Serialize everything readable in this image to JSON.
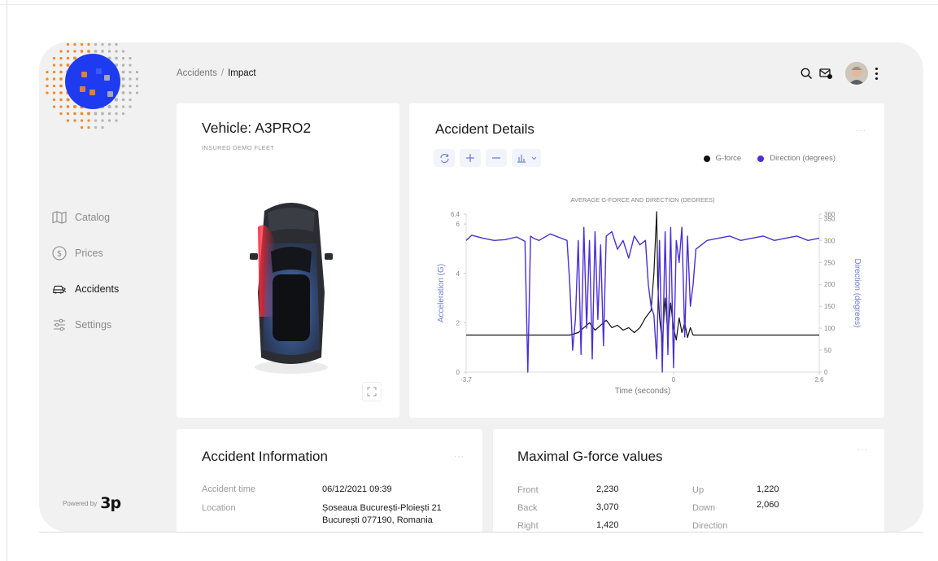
{
  "breadcrumb": {
    "parent": "Accidents",
    "separator": "/",
    "current": "Impact"
  },
  "sidebar": {
    "items": [
      {
        "label": "Catalog",
        "icon": "map-icon"
      },
      {
        "label": "Prices",
        "icon": "dollar-circle-icon"
      },
      {
        "label": "Accidents",
        "icon": "car-crash-icon",
        "active": true
      },
      {
        "label": "Settings",
        "icon": "sliders-icon"
      }
    ],
    "powered_by": "Powered by",
    "brand": "3p"
  },
  "vehicle": {
    "title": "Vehicle: A3PRO2",
    "subtitle": "INSURED DEMO FLEET"
  },
  "details": {
    "title": "Accident Details",
    "legend": [
      {
        "name": "G-force",
        "color": "#111111"
      },
      {
        "name": "Direction (degrees)",
        "color": "#4b2fd6"
      }
    ]
  },
  "chart_data": {
    "type": "line",
    "title": "AVERAGE G-FORCE AND DIRECTION (DEGREES)",
    "xlabel": "Time (seconds)",
    "ylabel": "Acceleration (G)",
    "y2label": "Direction (degrees)",
    "xlim": [
      -3.7,
      2.6
    ],
    "ylim": [
      0,
      6.4
    ],
    "y2lim": [
      0,
      360
    ],
    "x_ticks": [
      "-3.7",
      "0",
      "2.6"
    ],
    "y_ticks": [
      "0",
      "2",
      "4",
      "6",
      "6.4"
    ],
    "y2_ticks": [
      "0",
      "50",
      "100",
      "150",
      "200",
      "250",
      "300",
      "350",
      "360"
    ],
    "series": [
      {
        "name": "G-force",
        "axis": "left",
        "color": "#111111",
        "x": [
          -3.7,
          -1.85,
          -1.7,
          -1.6,
          -1.5,
          -1.4,
          -1.3,
          -1.2,
          -1.1,
          -1.0,
          -0.9,
          -0.8,
          -0.7,
          -0.6,
          -0.5,
          -0.4,
          -0.35,
          -0.3,
          -0.28,
          -0.25,
          -0.2,
          -0.15,
          -0.1,
          -0.05,
          0,
          0.05,
          0.1,
          0.15,
          0.2,
          0.25,
          0.3,
          0.35,
          0.4,
          0.5,
          2.6
        ],
        "y": [
          1.5,
          1.5,
          1.6,
          1.8,
          2.0,
          1.7,
          1.9,
          2.1,
          1.8,
          1.9,
          1.7,
          1.8,
          1.6,
          1.8,
          2.2,
          2.5,
          4.0,
          6.5,
          3.5,
          2.2,
          1.2,
          3.0,
          1.5,
          2.8,
          1.8,
          1.3,
          2.2,
          1.6,
          2.0,
          1.4,
          1.8,
          1.5,
          1.5,
          1.5,
          1.5
        ]
      },
      {
        "name": "Direction (degrees)",
        "axis": "right",
        "color": "#4b2fd6",
        "x": [
          -3.7,
          -3.6,
          -3.4,
          -3.2,
          -3.0,
          -2.8,
          -2.65,
          -2.6,
          -2.55,
          -2.5,
          -2.4,
          -2.2,
          -2.0,
          -1.9,
          -1.85,
          -1.8,
          -1.75,
          -1.7,
          -1.65,
          -1.6,
          -1.55,
          -1.5,
          -1.45,
          -1.4,
          -1.35,
          -1.3,
          -1.25,
          -1.2,
          -1.1,
          -1.0,
          -0.9,
          -0.8,
          -0.7,
          -0.6,
          -0.5,
          -0.45,
          -0.4,
          -0.35,
          -0.3,
          -0.25,
          -0.2,
          -0.15,
          -0.1,
          -0.05,
          0,
          0.05,
          0.1,
          0.15,
          0.2,
          0.25,
          0.3,
          0.35,
          0.4,
          0.5,
          0.6,
          0.8,
          1.0,
          1.2,
          1.4,
          1.6,
          1.8,
          2.0,
          2.2,
          2.4,
          2.6
        ],
        "y": [
          300,
          312,
          305,
          300,
          302,
          308,
          298,
          0,
          310,
          305,
          300,
          315,
          305,
          300,
          200,
          50,
          120,
          300,
          40,
          330,
          100,
          300,
          30,
          320,
          120,
          290,
          60,
          310,
          320,
          280,
          300,
          260,
          310,
          290,
          300,
          200,
          150,
          130,
          30,
          300,
          0,
          320,
          40,
          330,
          10,
          300,
          250,
          330,
          80,
          310,
          150,
          200,
          280,
          290,
          300,
          305,
          310,
          300,
          305,
          310,
          300,
          305,
          310,
          300,
          305
        ]
      }
    ]
  },
  "info": {
    "title": "Accident Information",
    "rows": [
      {
        "label": "Accident time",
        "value": "06/12/2021 09:39"
      },
      {
        "label": "Location",
        "value": "Șoseaua București-Ploiești 21",
        "value2": "București 077190, Romania"
      }
    ]
  },
  "gforce": {
    "title": "Maximal G-force values",
    "left": [
      {
        "label": "Front",
        "value": "2,230"
      },
      {
        "label": "Back",
        "value": "3,070"
      },
      {
        "label": "Right",
        "value": "1,420"
      }
    ],
    "right": [
      {
        "label": "Up",
        "value": "1,220"
      },
      {
        "label": "Down",
        "value": "2,060"
      },
      {
        "label": "Direction",
        "value": ""
      }
    ]
  },
  "colors": {
    "accent": "#4b2fd6",
    "logo_orange": "#f08a2a",
    "logo_blue": "#1f3bf0",
    "logo_gray": "#b4b4b4"
  }
}
